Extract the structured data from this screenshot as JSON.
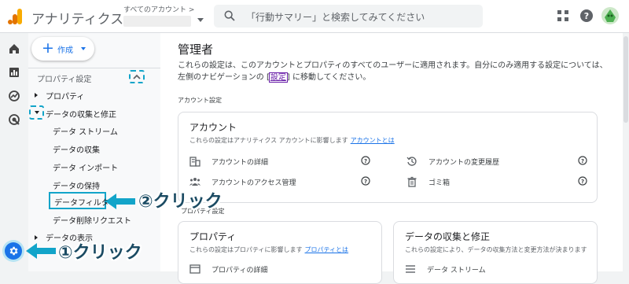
{
  "app": {
    "title": "アナリティクス",
    "account_label": "すべてのアカウント >",
    "search_placeholder": "「行動サマリー」と検索してみてください"
  },
  "nav": {
    "create_label": "作成",
    "section_title": "プロパティ設定",
    "items": [
      {
        "label": "プロパティ"
      },
      {
        "label": "データの収集と修正"
      },
      {
        "label": "データ ストリーム"
      },
      {
        "label": "データの収集"
      },
      {
        "label": "データ インポート"
      },
      {
        "label": "データの保持"
      },
      {
        "label": "データフィルタ"
      },
      {
        "label": "データ削除リクエスト"
      },
      {
        "label": "データの表示"
      }
    ]
  },
  "annotations": {
    "step1": "①クリック",
    "step2": "②クリック",
    "color": "#12a4c9"
  },
  "main": {
    "title": "管理者",
    "desc_before": "これらの設定は、このアカウントとプロパティのすべてのユーザーに適用されます。自分にのみ適用する設定については、左側のナビゲーションの [",
    "desc_link": "設定",
    "desc_after": "] に移動してください。",
    "section_account": "アカウント設定",
    "section_property_partial": "プロパティ設定",
    "account_card": {
      "title": "アカウント",
      "subtitle": "これらの設定はアナリティクス アカウントに影響します",
      "subtitle_link": "アカウントとは",
      "rows": [
        {
          "label": "アカウントの詳細",
          "icon": "building-icon"
        },
        {
          "label": "アカウントの変更履歴",
          "icon": "history-icon"
        },
        {
          "label": "アカウントのアクセス管理",
          "icon": "people-icon"
        },
        {
          "label": "ゴミ箱",
          "icon": "trash-icon"
        }
      ]
    },
    "property_card": {
      "title": "プロパティ",
      "subtitle": "これらの設定はプロパティに影響します",
      "subtitle_link": "プロパティとは",
      "rows": [
        {
          "label": "プロパティの詳細"
        }
      ]
    },
    "data_card": {
      "title": "データの収集と修正",
      "subtitle": "これらの設定により、データの収集方法と変更方法が決まります",
      "rows": [
        {
          "label": "データ ストリーム"
        }
      ]
    }
  },
  "colors": {
    "brand_blue": "#1a73e8",
    "highlight": "#12a4c9"
  }
}
